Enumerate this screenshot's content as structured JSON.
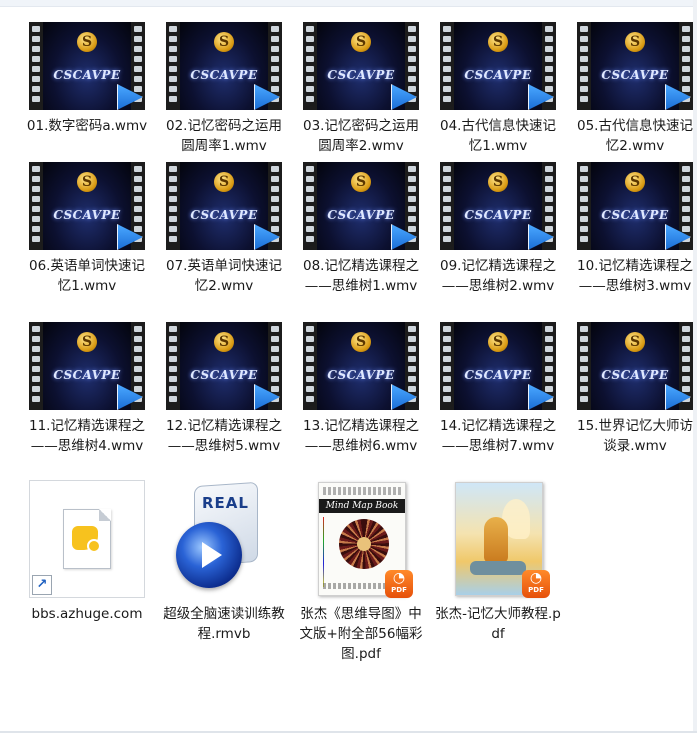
{
  "video_thumb": {
    "logo_letter": "S",
    "logo_text": "CSCAVPE"
  },
  "videos": [
    {
      "label": "01.数字密码a.wmv"
    },
    {
      "label": "02.记忆密码之运用圆周率1.wmv"
    },
    {
      "label": "03.记忆密码之运用圆周率2.wmv"
    },
    {
      "label": "04.古代信息快速记忆1.wmv"
    },
    {
      "label": "05.古代信息快速记忆2.wmv"
    },
    {
      "label": "06.英语单词快速记忆1.wmv"
    },
    {
      "label": "07.英语单词快速记忆2.wmv"
    },
    {
      "label": "08.记忆精选课程之——思维树1.wmv"
    },
    {
      "label": "09.记忆精选课程之——思维树2.wmv"
    },
    {
      "label": "10.记忆精选课程之——思维树3.wmv"
    },
    {
      "label": "11.记忆精选课程之——思维树4.wmv"
    },
    {
      "label": "12.记忆精选课程之——思维树5.wmv"
    },
    {
      "label": "13.记忆精选课程之——思维树6.wmv"
    },
    {
      "label": "14.记忆精选课程之——思维树7.wmv"
    },
    {
      "label": "15.世界记忆大师访谈录.wmv"
    }
  ],
  "files": [
    {
      "label": "bbs.azhuge.com",
      "icon": "shortcut-icon"
    },
    {
      "label": "超级全脑速读训练教程.rmvb",
      "icon": "realplayer-icon",
      "icon_text": "REAL"
    },
    {
      "label": "张杰《思维导图》中文版+附全部56幅彩图.pdf",
      "icon": "pdf-icon",
      "cover_title": "Mind Map Book",
      "badge": "PDF"
    },
    {
      "label": "张杰-记忆大师教程.pdf",
      "icon": "pdf-icon",
      "badge": "PDF"
    }
  ]
}
